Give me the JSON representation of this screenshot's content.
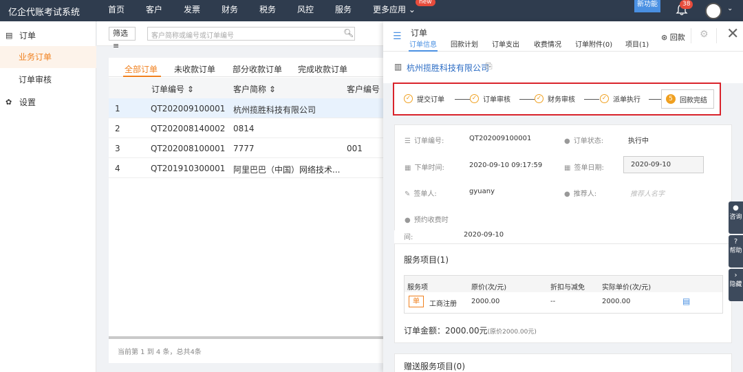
{
  "app": {
    "brand": "亿企代账考试系统"
  },
  "nav": {
    "items": [
      "首页",
      "客户",
      "发票",
      "财务",
      "税务",
      "风控",
      "服务",
      "更多应用 ⌄"
    ],
    "new_badge": "new",
    "new_feature": "新功能",
    "bell_count": "38"
  },
  "sidebar": {
    "group_order": "订单",
    "sub_items": [
      "业务订单",
      "订单审核"
    ],
    "group_settings": "设置"
  },
  "filter": {
    "button": "筛选 ≡",
    "placeholder": "客户简称或编号或订单编号"
  },
  "list": {
    "tabs": [
      "全部订单",
      "未收款订单",
      "部分收款订单",
      "完成收款订单"
    ],
    "columns": [
      "订单编号 ⇕",
      "客户简称 ⇕",
      "客户编号"
    ],
    "rows": [
      {
        "idx": "1",
        "order_no": "QT202009100001",
        "customer": "杭州揽胜科技有限公司",
        "cust_no": ""
      },
      {
        "idx": "2",
        "order_no": "QT202008140002",
        "customer": "0814",
        "cust_no": ""
      },
      {
        "idx": "3",
        "order_no": "QT202008100001",
        "customer": "7777",
        "cust_no": "001"
      },
      {
        "idx": "4",
        "order_no": "QT201910300001",
        "customer": "阿里巴巴（中国）网络技术...",
        "cust_no": ""
      }
    ],
    "pager": "当前第 1 到 4 条，总共4条"
  },
  "panel": {
    "title": "订单",
    "tabs": [
      "订单信息",
      "回款计划",
      "订单支出",
      "收费情况",
      "订单附件(0)",
      "项目(1)"
    ],
    "refund": "回款",
    "company": "杭州揽胜科技有限公司",
    "steps": [
      "提交订单",
      "订单审核",
      "财务审核",
      "派单执行",
      "回款完结"
    ],
    "step_last_num": "5",
    "info": {
      "order_no_label": "订单编号:",
      "order_no": "QT202009100001",
      "status_label": "订单状态:",
      "status": "执行中",
      "order_time_label": "下单时间:",
      "order_time": "2020-09-10 09:17:59",
      "sign_date_label": "签单日期:",
      "sign_date": "2020-09-10",
      "signer_label": "签单人:",
      "signer": "gyuany",
      "referrer_label": "推荐人:",
      "referrer_placeholder": "推荐人名字",
      "reserve_label": "预约收费时",
      "reserve_cont": "间:",
      "reserve_date": "2020-09-10"
    },
    "services": {
      "title": "服务项目(1)",
      "columns": [
        "服务项",
        "原价(次/元)",
        "折扣与减免",
        "实际单价(次/元)"
      ],
      "row": {
        "tag": "单",
        "name": "工商注册",
        "price": "2000.00",
        "discount": "--",
        "actual": "2000.00"
      },
      "total_label": "订单金额：2000.00元",
      "total_note": "(原价2000.00元)"
    },
    "gift_title": "赠送服务项目(0)"
  },
  "float": {
    "items": [
      "咨询",
      "帮助",
      "隐藏"
    ]
  }
}
